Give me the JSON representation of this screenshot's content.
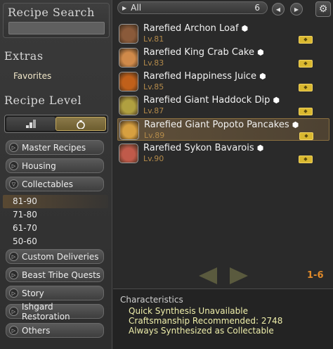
{
  "sidebar": {
    "recipe_search_title": "Recipe Search",
    "search_value": "",
    "extras_title": "Extras",
    "favorites_label": "Favorites",
    "recipe_level_title": "Recipe Level",
    "categories": [
      {
        "label": "Master Recipes",
        "expanded": false
      },
      {
        "label": "Housing",
        "expanded": false
      },
      {
        "label": "Collectables",
        "expanded": true
      }
    ],
    "levels": [
      "81-90",
      "71-80",
      "61-70",
      "50-60"
    ],
    "selected_level": "81-90",
    "categories_after": [
      {
        "label": "Custom Deliveries",
        "expanded": false
      },
      {
        "label": "Beast Tribe Quests",
        "expanded": false
      },
      {
        "label": "Story",
        "expanded": false
      },
      {
        "label": "Ishgard Restoration",
        "expanded": false
      },
      {
        "label": "Others",
        "expanded": false
      }
    ]
  },
  "list": {
    "filter_label": "All",
    "count": "6",
    "recipes": [
      {
        "name": "Rarefied Archon Loaf",
        "level": "Lv.81",
        "icon": "bread-icon",
        "color": "#8a5a3a"
      },
      {
        "name": "Rarefied King Crab Cake",
        "level": "Lv.83",
        "icon": "crab-cake-icon",
        "color": "#d08a4a"
      },
      {
        "name": "Rarefied Happiness Juice",
        "level": "Lv.85",
        "icon": "juice-icon",
        "color": "#c0601a"
      },
      {
        "name": "Rarefied Giant Haddock Dip",
        "level": "Lv.87",
        "icon": "dip-icon",
        "color": "#b0a040"
      },
      {
        "name": "Rarefied Giant Popoto Pancakes",
        "level": "Lv.89",
        "icon": "pancake-icon",
        "color": "#d7a040"
      },
      {
        "name": "Rarefied Sykon Bavarois",
        "level": "Lv.90",
        "icon": "bavarois-icon",
        "color": "#c05a4a"
      }
    ],
    "selected_index": 4,
    "range": "1-6"
  },
  "characteristics": {
    "title": "Characteristics",
    "lines": [
      "Quick Synthesis Unavailable",
      "Craftsmanship Recommended: 2748",
      "Always Synthesized as Collectable"
    ]
  }
}
